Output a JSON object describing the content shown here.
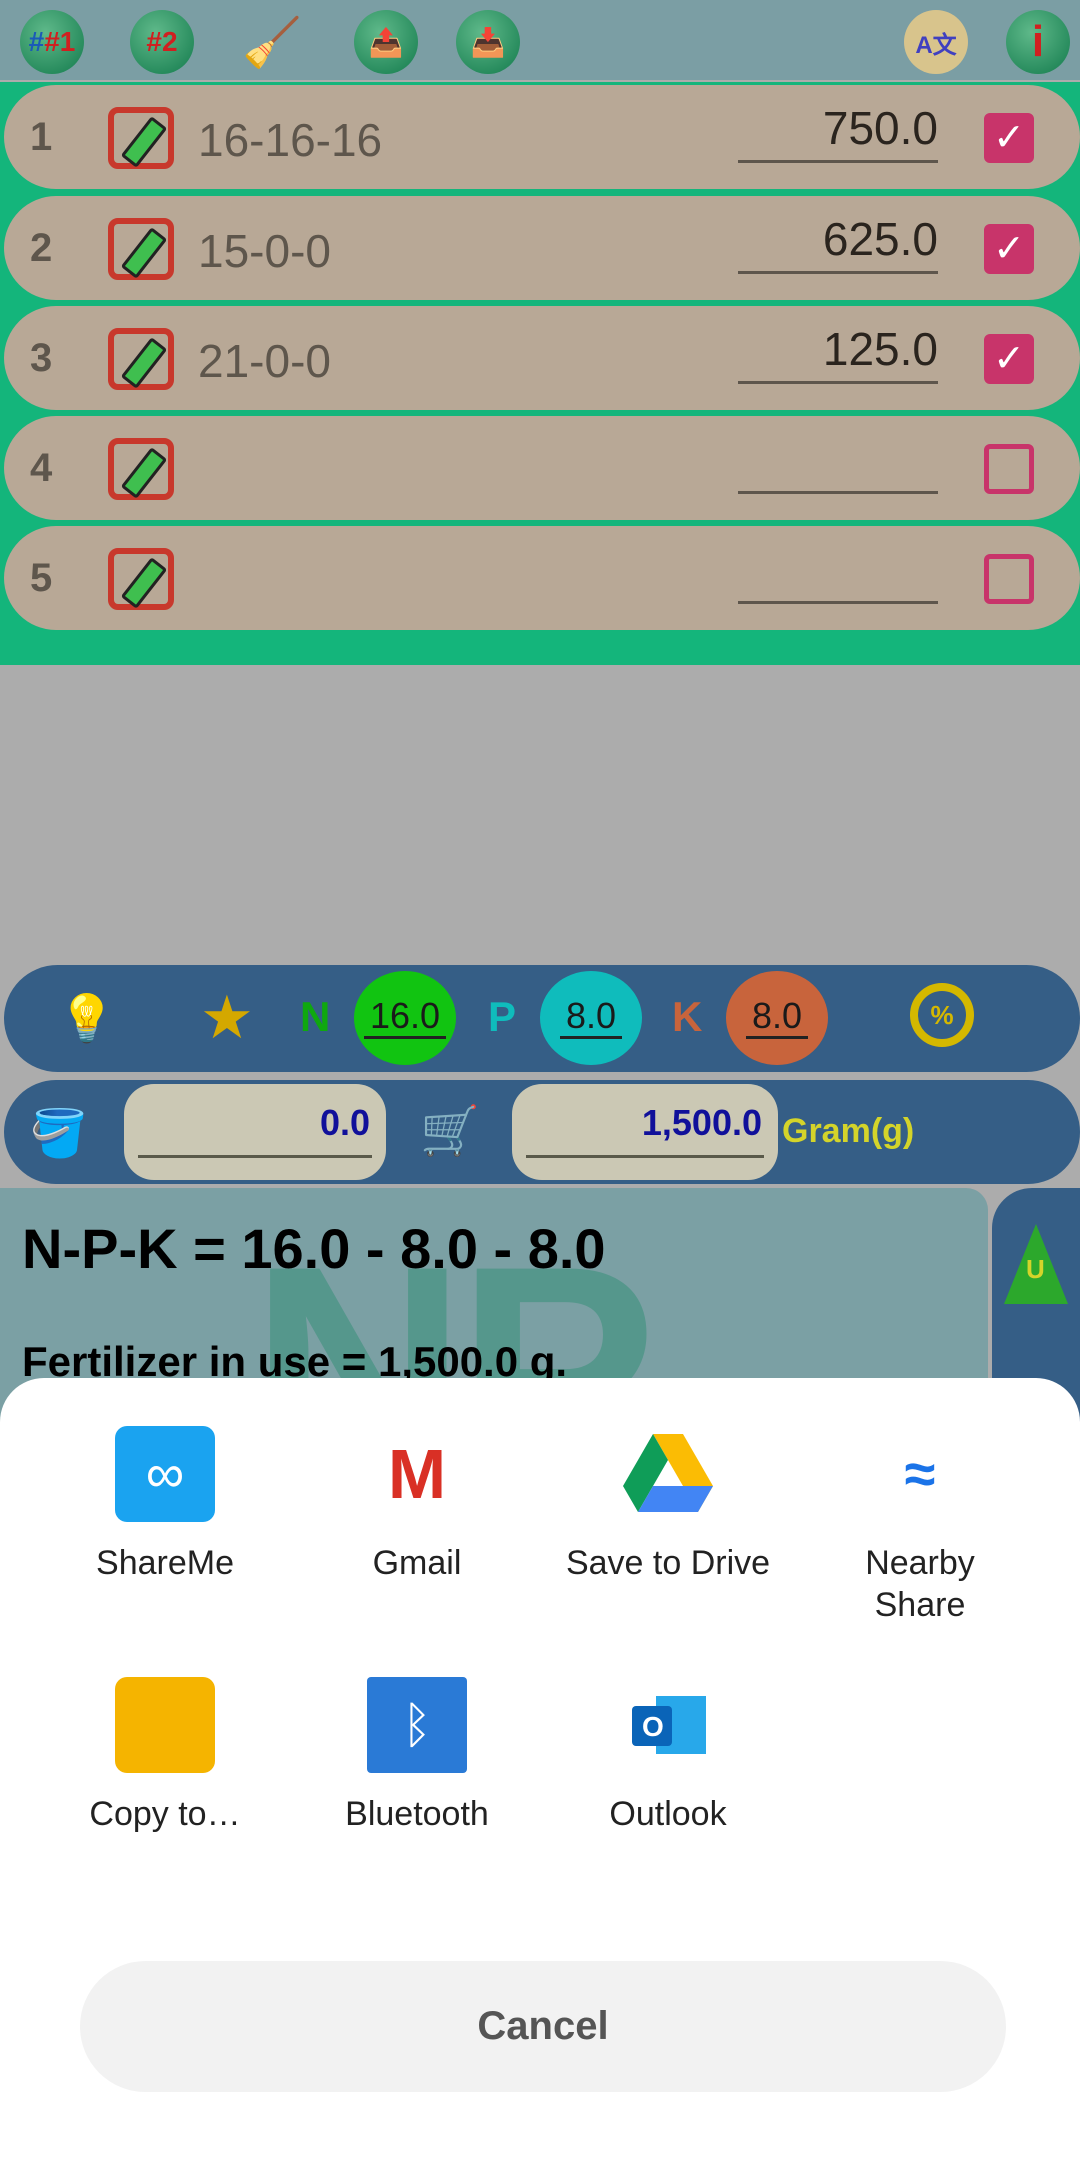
{
  "toolbar": {
    "b1": "#1",
    "b2": "#2",
    "items": [
      "preset-1",
      "preset-2",
      "clear",
      "export",
      "import",
      "language",
      "info"
    ]
  },
  "rows": [
    {
      "n": "1",
      "name": "16-16-16",
      "amount": "750.0",
      "checked": true
    },
    {
      "n": "2",
      "name": "15-0-0",
      "amount": "625.0",
      "checked": true
    },
    {
      "n": "3",
      "name": "21-0-0",
      "amount": "125.0",
      "checked": true
    },
    {
      "n": "4",
      "name": "",
      "amount": "",
      "checked": false
    },
    {
      "n": "5",
      "name": "",
      "amount": "",
      "checked": false
    }
  ],
  "npk": {
    "n_label": "N",
    "n": "16.0",
    "p_label": "P",
    "p": "8.0",
    "k_label": "K",
    "k": "8.0",
    "colors": {
      "n": "#11c411",
      "p": "#0fbcbc",
      "k": "#c8643c"
    }
  },
  "weights": {
    "water": "0.0",
    "total": "1,500.0",
    "unit": "Gram(g)"
  },
  "result": {
    "formula": "N-P-K = 16.0 - 8.0 - 8.0",
    "in_use": "Fertilizer in use = 1,500.0 g.",
    "watermark": "NP",
    "side_label": "U"
  },
  "share": {
    "apps": [
      {
        "label": "ShareMe"
      },
      {
        "label": "Gmail"
      },
      {
        "label": "Save to Drive"
      },
      {
        "label": "Nearby Share"
      },
      {
        "label": "Copy to…"
      },
      {
        "label": "Bluetooth"
      },
      {
        "label": "Outlook"
      }
    ],
    "cancel": "Cancel"
  }
}
